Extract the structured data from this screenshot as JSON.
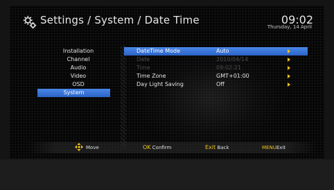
{
  "header": {
    "title": "Settings / System / Date Time",
    "time": "09:02",
    "date": "Thursday, 14 April"
  },
  "sidebar": {
    "items": [
      {
        "label": "Installation"
      },
      {
        "label": "Channel"
      },
      {
        "label": "Audio"
      },
      {
        "label": "Video"
      },
      {
        "label": "OSD"
      },
      {
        "label": "System",
        "selected": true
      }
    ]
  },
  "settings": {
    "rows": [
      {
        "label": "DateTime Mode",
        "value": "Auto",
        "state": "selected"
      },
      {
        "label": "Date",
        "value": "2010/04/14",
        "state": "disabled"
      },
      {
        "label": "Time",
        "value": "09:02:21",
        "state": "disabled"
      },
      {
        "label": "Time Zone",
        "value": "GMT+01:00",
        "state": "normal"
      },
      {
        "label": "Day Light Saving",
        "value": "Off",
        "state": "normal"
      }
    ]
  },
  "footer": {
    "move": "Move",
    "ok_key": "OK",
    "ok_label": "Confirm",
    "exit_key": "Exit",
    "exit_label": "Back",
    "menu_key": "MENU",
    "menu_label": "Exit"
  },
  "colors": {
    "highlight": "#3a76dc",
    "arrow": "#f0c419",
    "disabled_text": "#4d4d4d"
  }
}
